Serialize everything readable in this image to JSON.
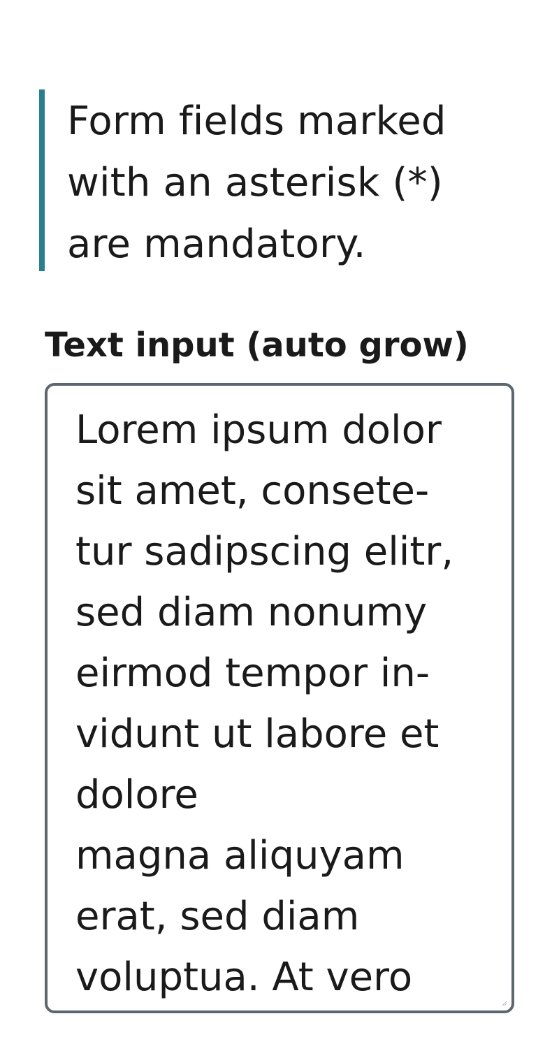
{
  "notice": {
    "text": "Form fields marked with an asterisk (*) are mandatory."
  },
  "field": {
    "label": "Text input (auto grow)",
    "value": "Lorem ipsum dolor sit amet, consete-\ntur sadipscing elitr, sed diam nonumy eirmod tempor in-\nvidunt ut labore et dolore\nmagna aliquyam erat, sed diam voluptua. At vero"
  },
  "colors": {
    "notice_border": "#2a7f8f",
    "field_border": "#5c6670",
    "text": "#1a1a1a"
  },
  "icons": {
    "resize": "resize-grip-icon"
  }
}
